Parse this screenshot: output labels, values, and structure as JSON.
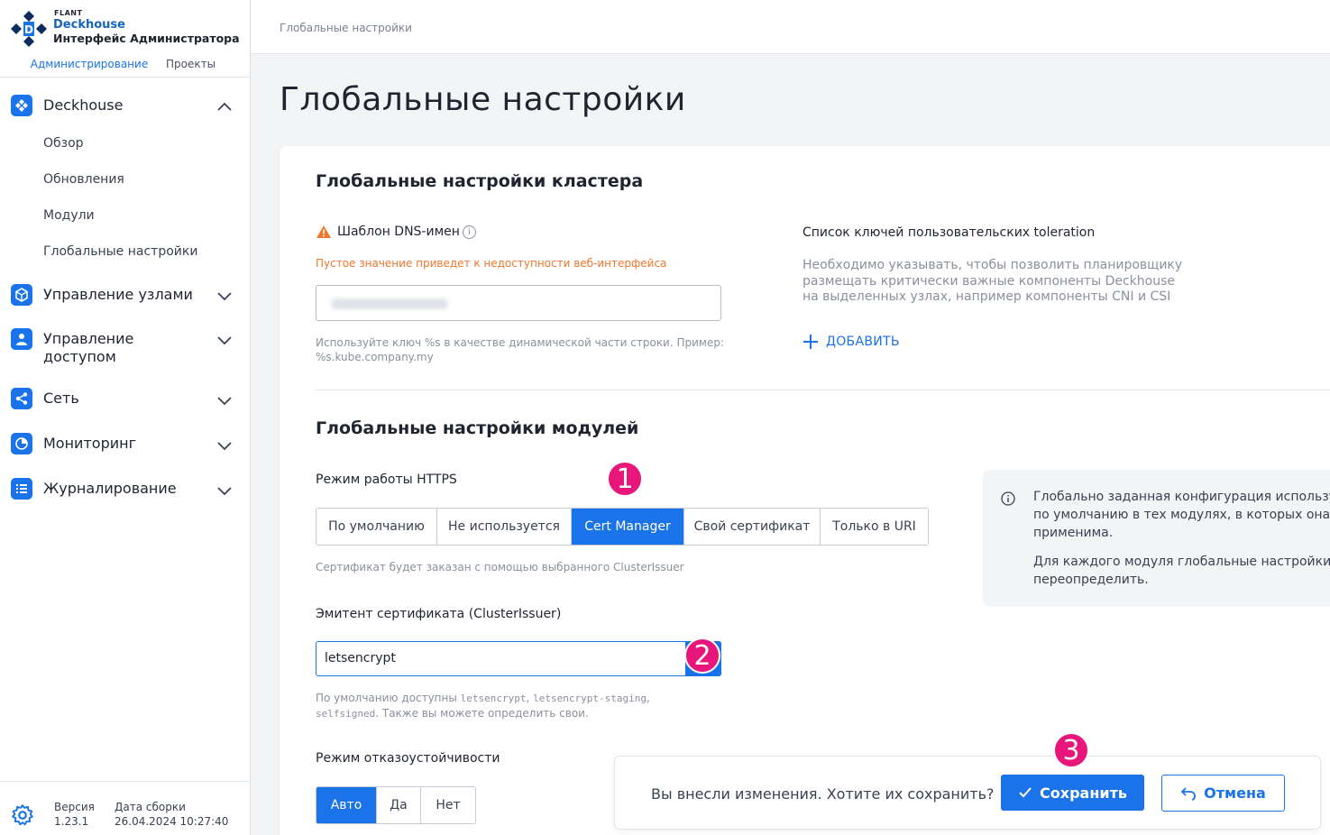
{
  "brand": {
    "company": "FLANT",
    "product": "Deckhouse",
    "subtitle": "Интерфейс Администратора"
  },
  "sidebar": {
    "tabs": [
      {
        "label": "Администрирование",
        "active": true
      },
      {
        "label": "Проекты",
        "active": false
      }
    ],
    "groups": [
      {
        "label": "Deckhouse",
        "icon": "deckhouse-icon",
        "expanded": true,
        "items": [
          "Обзор",
          "Обновления",
          "Модули",
          "Глобальные настройки"
        ]
      },
      {
        "label": "Управление узлами",
        "icon": "cube-icon"
      },
      {
        "label": "Управление доступом",
        "icon": "user-icon"
      },
      {
        "label": "Сеть",
        "icon": "share-icon"
      },
      {
        "label": "Мониторинг",
        "icon": "pie-icon"
      },
      {
        "label": "Журналирование",
        "icon": "list-icon"
      }
    ],
    "footer": {
      "version_label": "Версия",
      "version_value": "1.23.1",
      "build_label": "Дата сборки",
      "build_value": "26.04.2024 10:27:40"
    }
  },
  "breadcrumb": "Глобальные настройки",
  "page_title": "Глобальные настройки",
  "cluster": {
    "title": "Глобальные настройки кластера",
    "dns_label": "Шаблон DNS-имен",
    "dns_warning": "Пустое значение приведет к недоступности веб-интерфейса",
    "dns_hint_1": "Используйте ключ %s в качестве динамической части строки. Пример:",
    "dns_hint_2": "%s.kube.company.my",
    "tol_label": "Список ключей пользовательских toleration",
    "tol_desc_1": "Необходимо указывать, чтобы позволить планировщику",
    "tol_desc_2": "размещать критически важные компоненты Deckhouse",
    "tol_desc_3": "на выделенных узлах, например компоненты CNI и CSI",
    "add_label": "ДОБАВИТЬ"
  },
  "modules": {
    "title": "Глобальные настройки модулей",
    "https_label": "Режим работы HTTPS",
    "https_options": [
      "По умолчанию",
      "Не используется",
      "Cert Manager",
      "Свой сертификат",
      "Только в URI"
    ],
    "https_selected": "Cert Manager",
    "https_hint": "Сертификат будет заказан с помощью выбранного ClusterIssuer",
    "issuer_label": "Эмитент сертификата (ClusterIssuer)",
    "issuer_value": "letsencrypt",
    "issuer_hint_pre": "По умолчанию доступны ",
    "issuer_hint_code1": "letsencrypt",
    "issuer_hint_sep": ", ",
    "issuer_hint_code2": "letsencrypt-staging",
    "issuer_hint_comma": ",",
    "issuer_hint_code3": "selfsigned",
    "issuer_hint_post": ". Также вы можете определить свои.",
    "ha_label": "Режим отказоустойчивости",
    "ha_options": [
      "Авто",
      "Да",
      "Нет"
    ],
    "ha_selected": "Авто",
    "info_1": "Глобально заданная конфигурация используется",
    "info_2": "по умолчанию в тех модулях, в которых она",
    "info_3": "применима.",
    "info_4": "Для каждого модуля глобальные настройки можно",
    "info_5": "переопределить."
  },
  "badges": [
    "1",
    "2",
    "3"
  ],
  "save_bar": {
    "question": "Вы внесли изменения. Хотите их сохранить?",
    "save_label": "Сохранить",
    "cancel_label": "Отмена"
  },
  "colors": {
    "accent": "#1a73e8",
    "warning": "#f0772e",
    "badge": "#e8157a"
  }
}
